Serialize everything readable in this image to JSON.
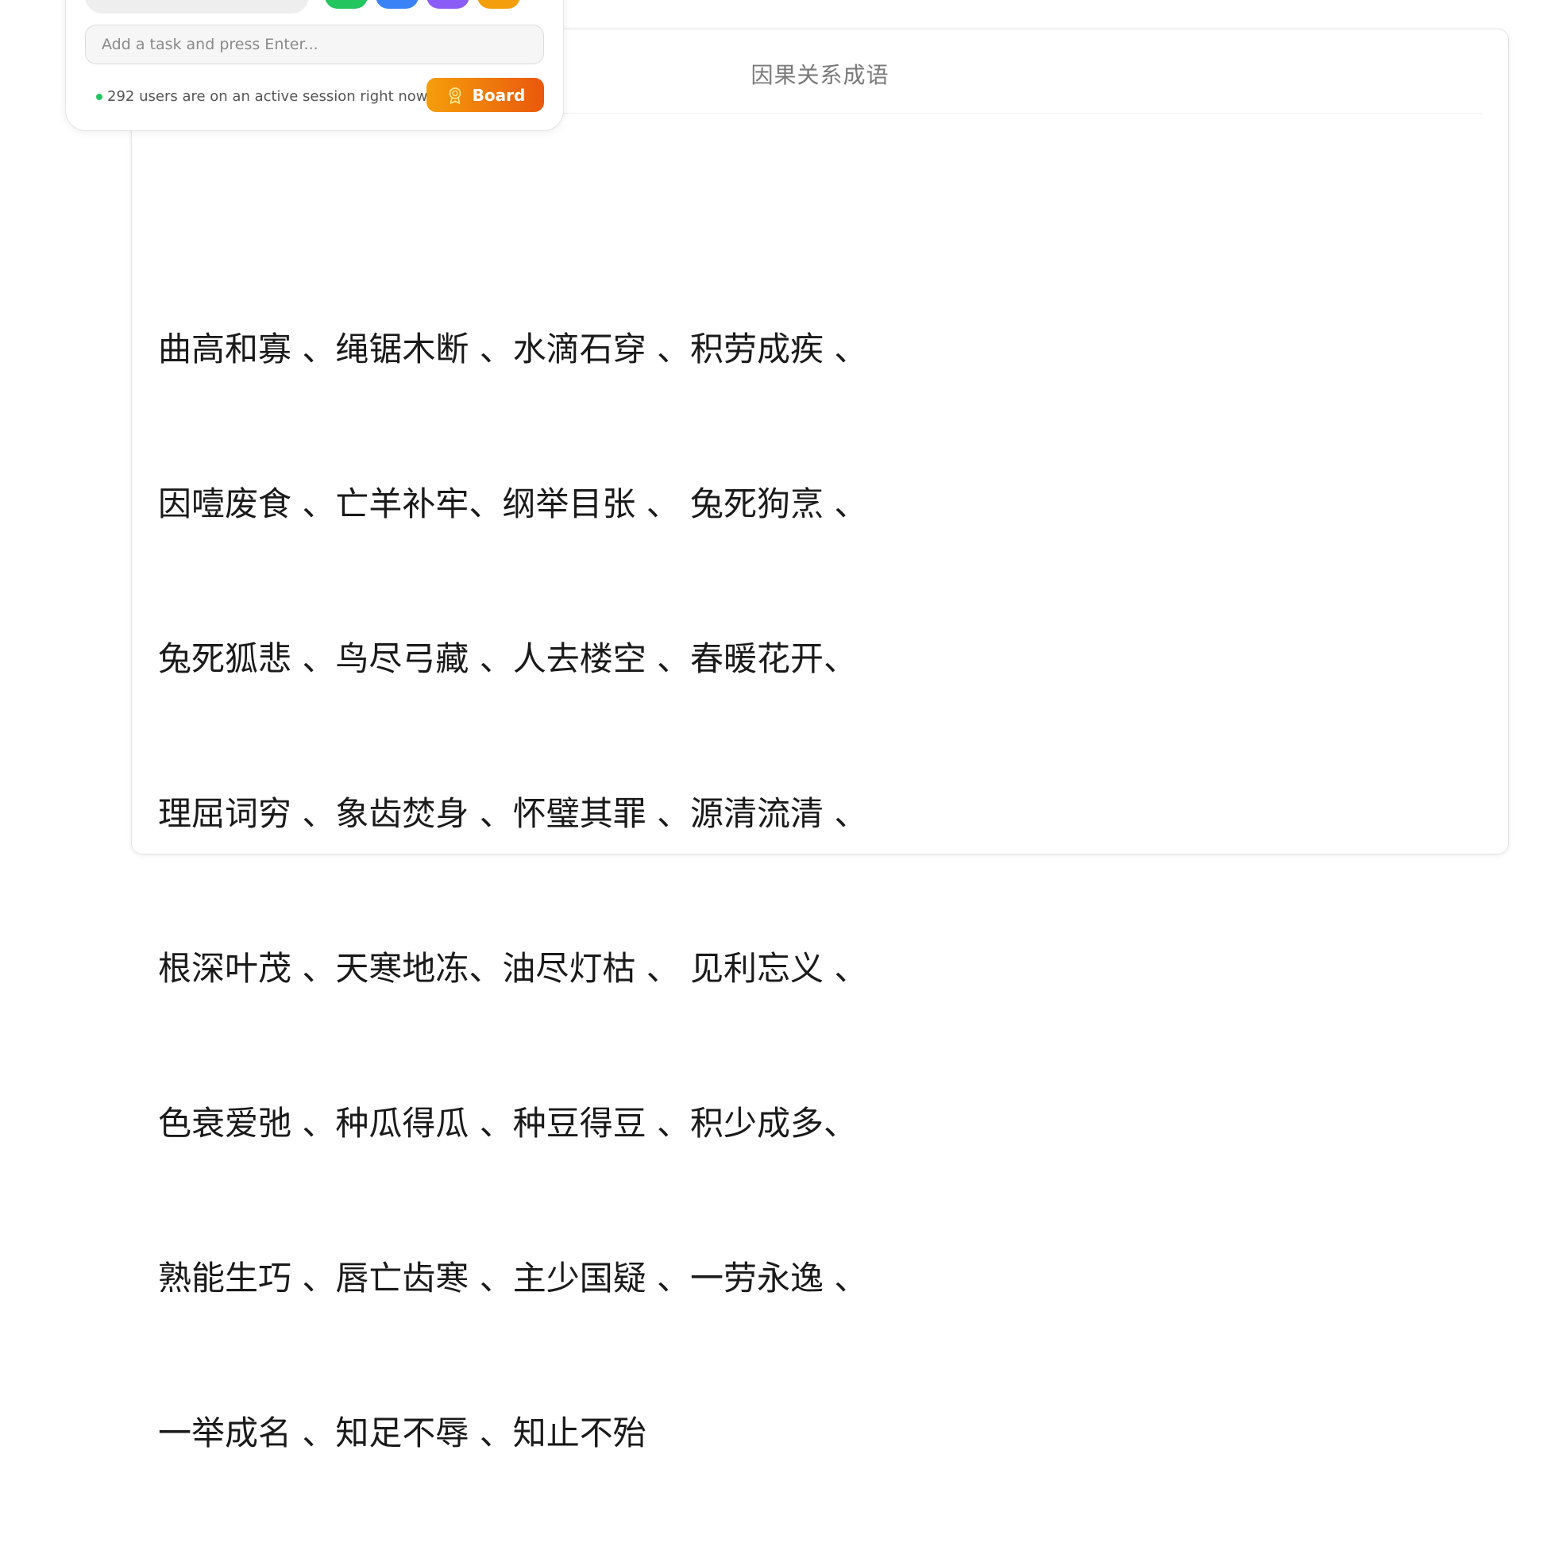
{
  "panel": {
    "input_placeholder": "Add a task and press Enter...",
    "status_text": "292 users are on an active session right now",
    "board_label": "Board",
    "color_swatches": [
      "#22c55e",
      "#3b82f6",
      "#8b5cf6",
      "#f59e0b"
    ],
    "accent_gradient": [
      "#f59e0b",
      "#ea580c"
    ]
  },
  "document": {
    "title": "因果关系成语",
    "lines": [
      "曲高和寡 、绳锯木断 、水滴石穿 、积劳成疾 、",
      "因噎废食 、亡羊补牢、纲举目张 、 兔死狗烹 、",
      "兔死狐悲 、鸟尽弓藏 、人去楼空 、春暖花开、",
      "理屈词穷 、象齿焚身 、怀璧其罪 、源清流清 、",
      "根深叶茂 、天寒地冻、油尽灯枯 、 见利忘义 、",
      "色衰爱弛 、种瓜得瓜 、种豆得豆 、积少成多、",
      "熟能生巧 、唇亡齿寒 、主少国疑 、一劳永逸 、",
      "一举成名 、知足不辱 、知止不殆"
    ]
  }
}
